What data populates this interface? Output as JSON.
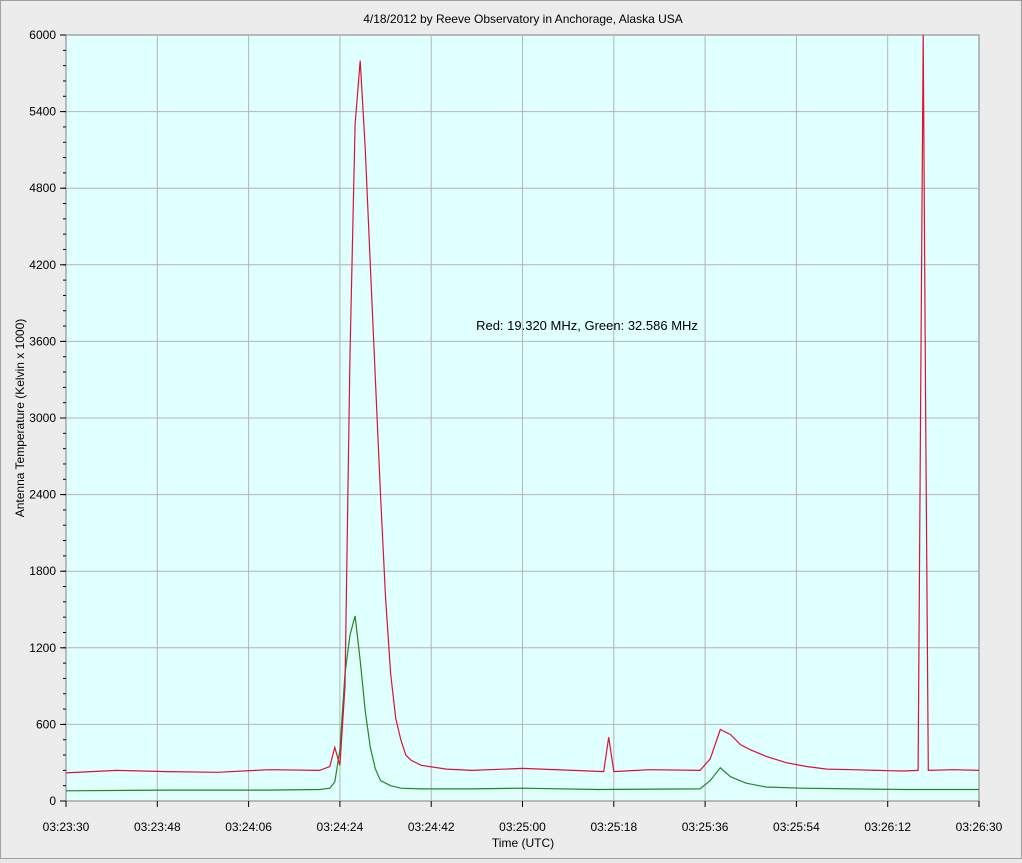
{
  "chart_data": {
    "type": "line",
    "title": "4/18/2012  by  Reeve Observatory  in  Anchorage, Alaska  USA",
    "xlabel": "Time (UTC)",
    "ylabel": "Antenna Temperature (Kelvin x 1000)",
    "annotation": "Red: 19.320 MHz, Green: 32.586 MHz",
    "xlim": [
      "03:23:30",
      "03:26:30"
    ],
    "ylim": [
      0,
      6000
    ],
    "x_ticks": [
      "03:23:30",
      "03:23:48",
      "03:24:06",
      "03:24:24",
      "03:24:42",
      "03:25:00",
      "03:25:18",
      "03:25:36",
      "03:25:54",
      "03:26:12",
      "03:26:30"
    ],
    "y_ticks": [
      0,
      600,
      1200,
      1800,
      2400,
      3000,
      3600,
      4200,
      4800,
      5400,
      6000
    ],
    "grid": true,
    "colors": {
      "plot_bg": "#e0ffff",
      "grid": "#b4b4b4",
      "red": "#dd1133",
      "green": "#228822"
    },
    "series": [
      {
        "name": "Red: 19.320 MHz",
        "color": "#dd1133",
        "x": [
          "03:23:30",
          "03:23:40",
          "03:23:50",
          "03:24:00",
          "03:24:10",
          "03:24:20",
          "03:24:22",
          "03:24:23",
          "03:24:24",
          "03:24:25",
          "03:24:26",
          "03:24:27",
          "03:24:28",
          "03:24:29",
          "03:24:30",
          "03:24:31",
          "03:24:32",
          "03:24:33",
          "03:24:34",
          "03:24:35",
          "03:24:36",
          "03:24:37",
          "03:24:38",
          "03:24:40",
          "03:24:45",
          "03:24:50",
          "03:25:00",
          "03:25:10",
          "03:25:16",
          "03:25:17",
          "03:25:18",
          "03:25:25",
          "03:25:35",
          "03:25:37",
          "03:25:39",
          "03:25:41",
          "03:25:43",
          "03:25:45",
          "03:25:48",
          "03:25:52",
          "03:25:56",
          "03:26:00",
          "03:26:05",
          "03:26:10",
          "03:26:15",
          "03:26:18",
          "03:26:18.5",
          "03:26:19",
          "03:26:19.5",
          "03:26:20",
          "03:26:25",
          "03:26:30"
        ],
        "values": [
          220,
          240,
          230,
          225,
          245,
          240,
          270,
          420,
          280,
          900,
          3500,
          5300,
          5800,
          5100,
          4200,
          3300,
          2400,
          1600,
          1000,
          650,
          480,
          360,
          320,
          280,
          250,
          240,
          255,
          240,
          230,
          500,
          230,
          245,
          240,
          330,
          560,
          520,
          440,
          400,
          350,
          300,
          270,
          250,
          245,
          240,
          235,
          240,
          3200,
          6000,
          3000,
          240,
          245,
          240
        ]
      },
      {
        "name": "Green: 32.586 MHz",
        "color": "#228822",
        "x": [
          "03:23:30",
          "03:23:50",
          "03:24:10",
          "03:24:20",
          "03:24:22",
          "03:24:23",
          "03:24:24",
          "03:24:25",
          "03:24:26",
          "03:24:27",
          "03:24:28",
          "03:24:29",
          "03:24:30",
          "03:24:31",
          "03:24:32",
          "03:24:34",
          "03:24:36",
          "03:24:40",
          "03:24:50",
          "03:25:00",
          "03:25:15",
          "03:25:35",
          "03:25:37",
          "03:25:39",
          "03:25:41",
          "03:25:44",
          "03:25:48",
          "03:25:55",
          "03:26:05",
          "03:26:15",
          "03:26:30"
        ],
        "values": [
          80,
          85,
          85,
          90,
          100,
          150,
          400,
          1000,
          1300,
          1450,
          1100,
          700,
          420,
          250,
          160,
          120,
          100,
          95,
          95,
          100,
          90,
          95,
          160,
          260,
          190,
          140,
          110,
          100,
          95,
          90,
          90
        ]
      }
    ]
  }
}
